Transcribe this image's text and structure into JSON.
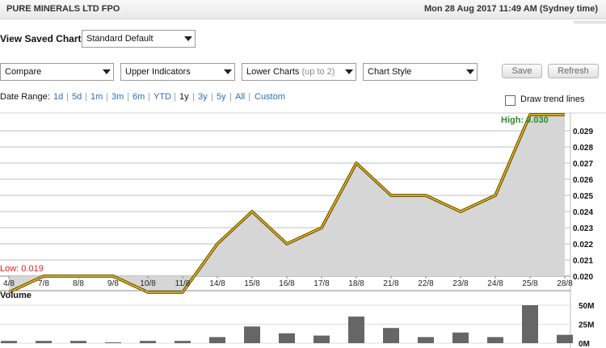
{
  "header": {
    "title": "PURE MINERALS LTD FPO",
    "datetime": "Mon 28 Aug 2017 11:49 AM (Sydney time)"
  },
  "saved_chart": {
    "label": "View Saved Chart:",
    "value": "Standard Default"
  },
  "toolbar": {
    "compare": "Compare",
    "upper_indicators": "Upper Indicators",
    "lower_charts": "Lower Charts",
    "lower_charts_hint": "(up to 2)",
    "chart_style": "Chart Style",
    "save": "Save",
    "refresh": "Refresh"
  },
  "date_range": {
    "label": "Date Range:",
    "options": [
      "1d",
      "5d",
      "1m",
      "3m",
      "6m",
      "YTD",
      "1y",
      "3y",
      "5y",
      "All",
      "Custom"
    ],
    "active": "1y"
  },
  "trend": {
    "label": "Draw trend lines",
    "checked": false
  },
  "chart_data": {
    "type": "area",
    "x": [
      "4/8",
      "7/8",
      "8/8",
      "9/8",
      "10/8",
      "11/8",
      "14/8",
      "15/8",
      "16/8",
      "17/8",
      "18/8",
      "21/8",
      "22/8",
      "23/8",
      "24/8",
      "25/8",
      "28/8"
    ],
    "series": [
      {
        "values": [
          0.019,
          0.02,
          0.02,
          0.02,
          0.019,
          0.019,
          0.022,
          0.024,
          0.022,
          0.023,
          0.027,
          0.025,
          0.025,
          0.024,
          0.025,
          0.03,
          0.03
        ]
      }
    ],
    "yticks": [
      "0.029",
      "0.028",
      "0.027",
      "0.026",
      "0.025",
      "0.024",
      "0.023",
      "0.022",
      "0.021",
      "0.020"
    ],
    "high_label": "High: 0.030",
    "low_label": "Low: 0.019",
    "line_color": "#f0b800",
    "fill_color": "#d6d6d6",
    "volume": {
      "label": "Volume",
      "ticks": [
        "50M",
        "25M",
        "0M"
      ],
      "values_m": [
        3,
        3,
        3,
        1,
        3,
        3,
        8,
        22,
        13,
        10,
        35,
        20,
        8,
        14,
        8,
        50,
        11
      ],
      "bar_color": "#666666"
    }
  }
}
